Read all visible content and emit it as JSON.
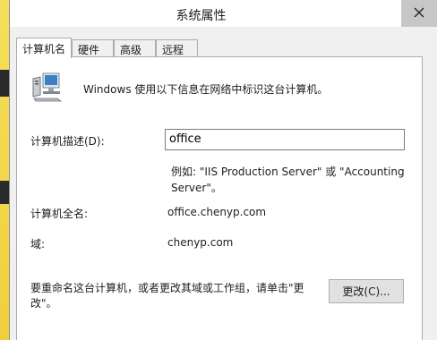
{
  "window": {
    "title": "系统属性"
  },
  "tabs": [
    {
      "label": "计算机名"
    },
    {
      "label": "硬件"
    },
    {
      "label": "高级"
    },
    {
      "label": "远程"
    }
  ],
  "panel": {
    "intro": "Windows 使用以下信息在网络中标识这台计算机。",
    "description_label": "计算机描述(D):",
    "description_value": "office",
    "example_line1": "例如: \"IIS Production Server\" 或 \"Accounting",
    "example_line2": "Server\"。",
    "fullname_label": "计算机全名:",
    "fullname_value": "office.chenyp.com",
    "domain_label": "域:",
    "domain_value": "chenyp.com",
    "rename_text_line1": "要重命名这台计算机，或者更改其域或工作组，请单击\"更",
    "rename_text_line2": "改\"。",
    "change_button": "更改(C)..."
  },
  "icons": {
    "close": "close-icon",
    "computer": "computer-icon"
  }
}
